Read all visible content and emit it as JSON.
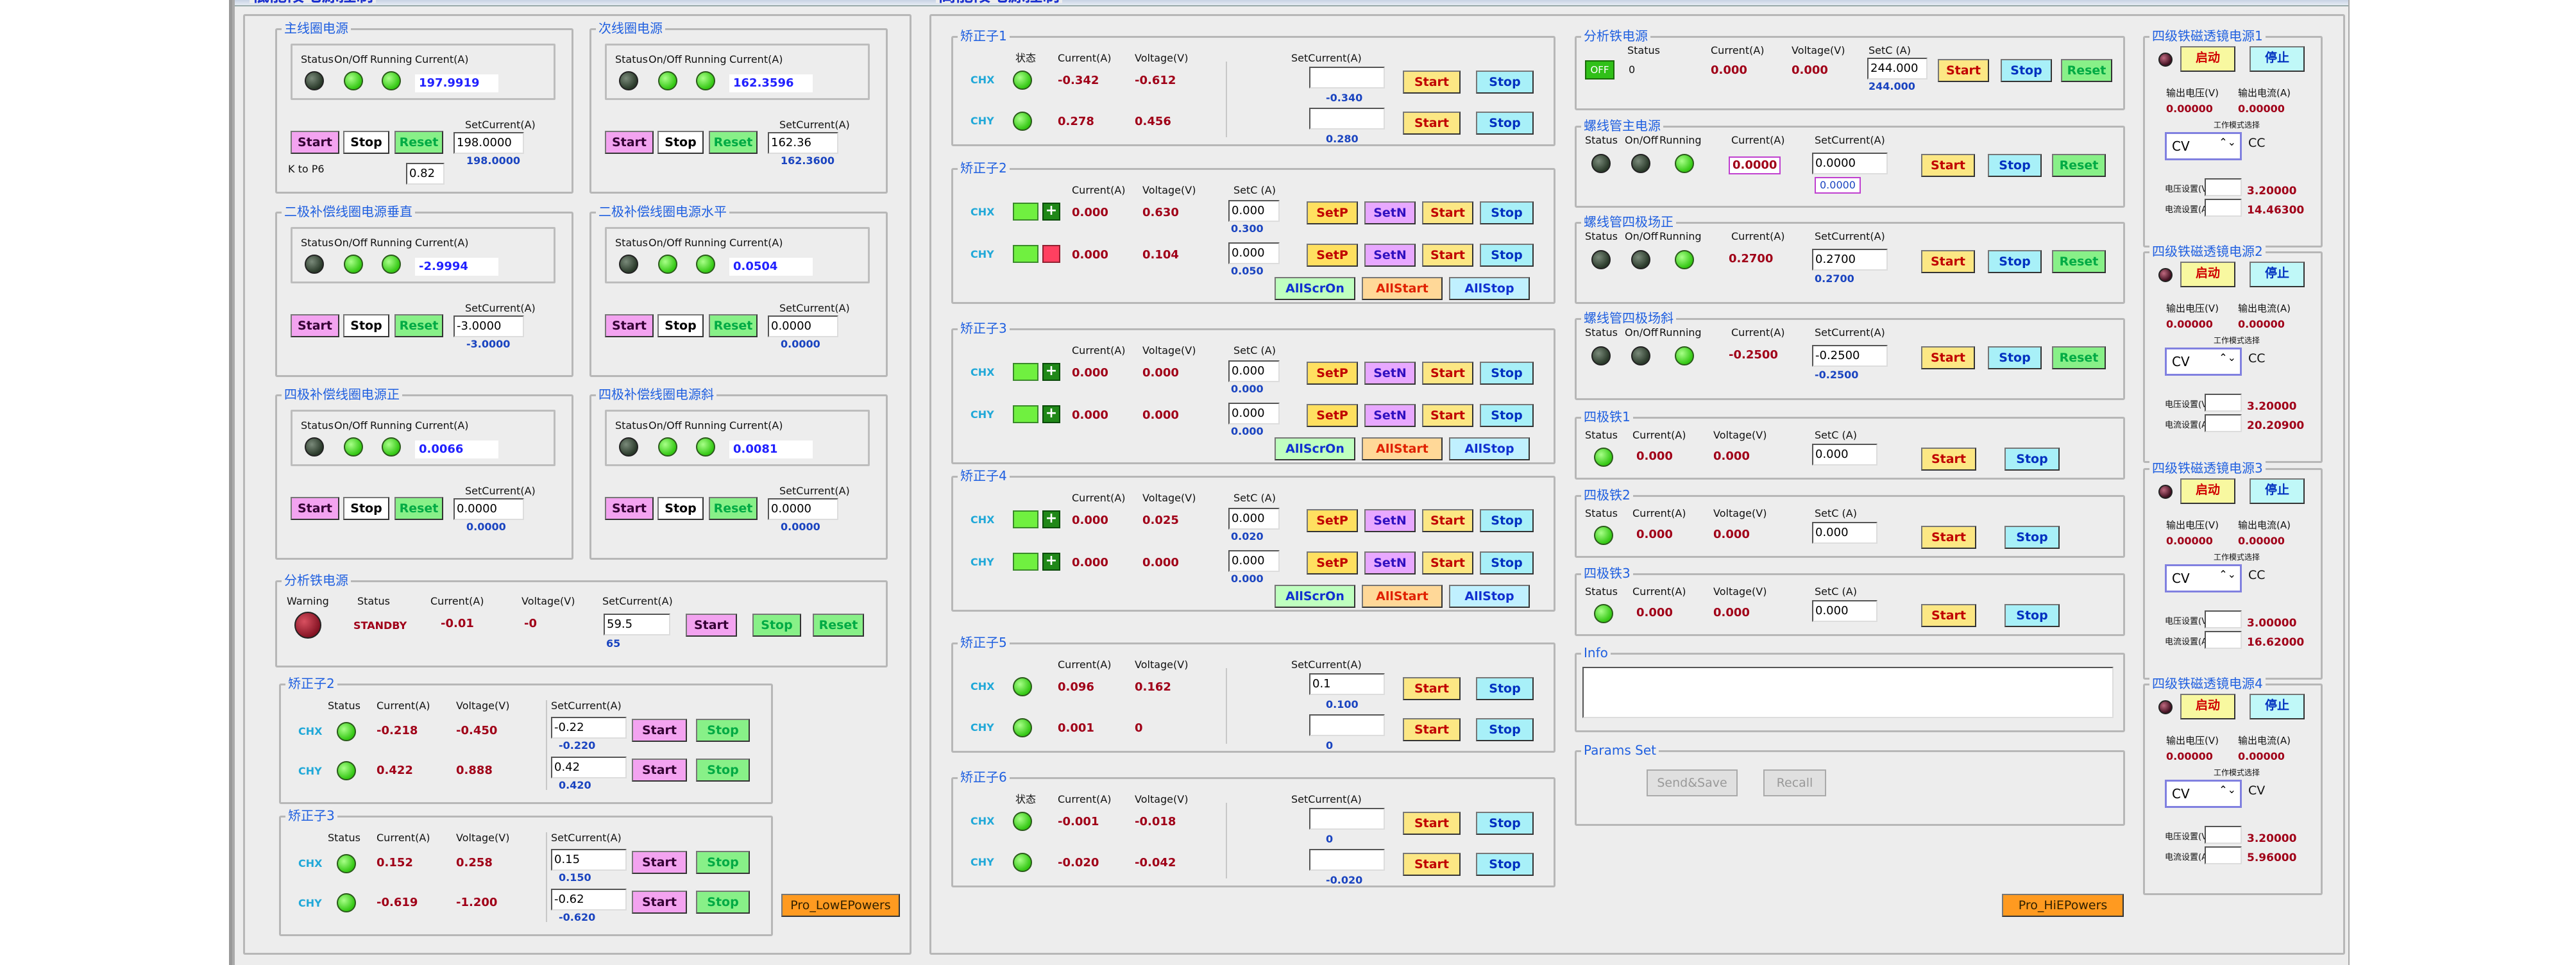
{
  "low": {
    "title": "低能段电源控制",
    "main_ps": {
      "title": "主线圈电源",
      "status": "Status",
      "onoff": "On/Off",
      "running": "Running",
      "current": "Current(A)",
      "value": "197.9919",
      "setcur": "SetCurrent(A)",
      "input": "198.0000",
      "readback": "198.0000",
      "kp": "K to P6",
      "kpv": "0.82",
      "start": "Start",
      "stop": "Stop",
      "reset": "Reset"
    },
    "sub_ps": {
      "title": "次线圈电源",
      "status": "Status",
      "onoff": "On/Off",
      "running": "Running",
      "current": "Current(A)",
      "value": "162.3596",
      "setcur": "SetCurrent(A)",
      "input": "162.36",
      "readback": "162.3600",
      "start": "Start",
      "stop": "Stop",
      "reset": "Reset"
    },
    "dip_v": {
      "title": "二极补偿线圈电源垂直",
      "status": "Status",
      "onoff": "On/Off",
      "running": "Running",
      "current": "Current(A)",
      "value": "-2.9994",
      "setcur": "SetCurrent(A)",
      "input": "-3.0000",
      "readback": "-3.0000",
      "start": "Start",
      "stop": "Stop",
      "reset": "Reset"
    },
    "dip_h": {
      "title": "二极补偿线圈电源水平",
      "status": "Status",
      "onoff": "On/Off",
      "running": "Running",
      "current": "Current(A)",
      "value": "0.0504",
      "setcur": "SetCurrent(A)",
      "input": "0.0000",
      "readback": "0.0000",
      "start": "Start",
      "stop": "Stop",
      "reset": "Reset"
    },
    "quad_n": {
      "title": "四极补偿线圈电源正",
      "status": "Status",
      "onoff": "On/Off",
      "running": "Running",
      "current": "Current(A)",
      "value": "0.0066",
      "setcur": "SetCurrent(A)",
      "input": "0.0000",
      "readback": "0.0000",
      "start": "Start",
      "stop": "Stop",
      "reset": "Reset"
    },
    "quad_s": {
      "title": "四极补偿线圈电源斜",
      "status": "Status",
      "onoff": "On/Off",
      "running": "Running",
      "current": "Current(A)",
      "value": "0.0081",
      "setcur": "SetCurrent(A)",
      "input": "0.0000",
      "readback": "0.0000",
      "start": "Start",
      "stop": "Stop",
      "reset": "Reset"
    },
    "analyzer": {
      "title": "分析铁电源",
      "warning": "Warning",
      "status": "Status",
      "current": "Current(A)",
      "voltage": "Voltage(V)",
      "setcur": "SetCurrent(A)",
      "status_val": "STANDBY",
      "cur_val": "-0.01",
      "volt_val": "-0",
      "input": "59.5",
      "readback": "65",
      "start": "Start",
      "stop": "Stop",
      "reset": "Reset"
    },
    "corr2": {
      "title": "矫正子2",
      "status": "Status",
      "current": "Current(A)",
      "voltage": "Voltage(V)",
      "setcur": "SetCurrent(A)",
      "chx": "CHX",
      "chy": "CHY",
      "x_cur": "-0.218",
      "x_volt": "-0.450",
      "x_in": "-0.22",
      "x_rb": "-0.220",
      "y_cur": "0.422",
      "y_volt": "0.888",
      "y_in": "0.42",
      "y_rb": "0.420",
      "start": "Start",
      "stop": "Stop"
    },
    "corr3": {
      "title": "矫正子3",
      "status": "Status",
      "current": "Current(A)",
      "voltage": "Voltage(V)",
      "setcur": "SetCurrent(A)",
      "chx": "CHX",
      "chy": "CHY",
      "x_cur": "0.152",
      "x_volt": "0.258",
      "x_in": "0.15",
      "x_rb": "0.150",
      "y_cur": "-0.619",
      "y_volt": "-1.200",
      "y_in": "-0.62",
      "y_rb": "-0.620",
      "start": "Start",
      "stop": "Stop"
    },
    "pro_btn": "Pro_LowEPowers"
  },
  "high": {
    "title": "高能段电源控制",
    "c1": {
      "title": "矫正子1",
      "state": "状态",
      "current": "Current(A)",
      "voltage": "Voltage(V)",
      "setcur": "SetCurrent(A)",
      "chx": "CHX",
      "chy": "CHY",
      "x_cur": "-0.342",
      "x_volt": "-0.612",
      "x_in": "",
      "x_rb": "-0.340",
      "y_cur": "0.278",
      "y_volt": "0.456",
      "y_in": "",
      "y_rb": "0.280",
      "start": "Start",
      "stop": "Stop"
    },
    "c2": {
      "title": "矫正子2",
      "current": "Current(A)",
      "voltage": "Voltage(V)",
      "setc": "SetC (A)",
      "chx": "CHX",
      "chy": "CHY",
      "x_cur": "0.000",
      "x_volt": "0.630",
      "x_in": "0.000",
      "x_rb": "0.300",
      "y_cur": "0.000",
      "y_volt": "0.104",
      "y_in": "0.000",
      "y_rb": "0.050",
      "setp": "SetP",
      "setn": "SetN",
      "start": "Start",
      "stop": "Stop",
      "allon": "AllScrOn",
      "allstart": "AllStart",
      "allstop": "AllStop"
    },
    "c3": {
      "title": "矫正子3",
      "current": "Current(A)",
      "voltage": "Voltage(V)",
      "setc": "SetC (A)",
      "chx": "CHX",
      "chy": "CHY",
      "x_cur": "0.000",
      "x_volt": "0.000",
      "x_in": "0.000",
      "x_rb": "0.000",
      "y_cur": "0.000",
      "y_volt": "0.000",
      "y_in": "0.000",
      "y_rb": "0.000",
      "setp": "SetP",
      "setn": "SetN",
      "start": "Start",
      "stop": "Stop",
      "allon": "AllScrOn",
      "allstart": "AllStart",
      "allstop": "AllStop",
      "plus": "+"
    },
    "c4": {
      "title": "矫正子4",
      "current": "Current(A)",
      "voltage": "Voltage(V)",
      "setc": "SetC (A)",
      "chx": "CHX",
      "chy": "CHY",
      "x_cur": "0.000",
      "x_volt": "0.025",
      "x_in": "0.000",
      "x_rb": "0.020",
      "y_cur": "0.000",
      "y_volt": "0.000",
      "y_in": "0.000",
      "y_rb": "0.000",
      "setp": "SetP",
      "setn": "SetN",
      "start": "Start",
      "stop": "Stop",
      "allon": "AllScrOn",
      "allstart": "AllStart",
      "allstop": "AllStop"
    },
    "c5": {
      "title": "矫正子5",
      "current": "Current(A)",
      "voltage": "Voltage(V)",
      "setcur": "SetCurrent(A)",
      "chx": "CHX",
      "chy": "CHY",
      "x_cur": "0.096",
      "x_volt": "0.162",
      "x_in": "0.1",
      "x_rb": "0.100",
      "y_cur": "0.001",
      "y_volt": "0",
      "y_in": "",
      "y_rb": "0",
      "start": "Start",
      "stop": "Stop"
    },
    "c6": {
      "title": "矫正子6",
      "state": "状态",
      "current": "Current(A)",
      "voltage": "Voltage(V)",
      "setcur": "SetCurrent(A)",
      "chx": "CHX",
      "chy": "CHY",
      "x_cur": "-0.001",
      "x_volt": "-0.018",
      "x_in": "",
      "x_rb": "0",
      "y_cur": "-0.020",
      "y_volt": "-0.042",
      "y_in": "",
      "y_rb": "-0.020",
      "start": "Start",
      "stop": "Stop"
    },
    "an": {
      "title": "分析铁电源",
      "status": "Status",
      "current": "Current(A)",
      "voltage": "Voltage(V)",
      "setc": "SetC (A)",
      "off": "OFF",
      "status_val": "0",
      "cur_val": "0.000",
      "volt_val": "0.000",
      "input": "244.000",
      "readback": "244.000",
      "start": "Start",
      "stop": "Stop",
      "reset": "Reset"
    },
    "sol": {
      "title": "螺线管主电源",
      "status": "Status",
      "onoff": "On/Off",
      "running": "Running",
      "current": "Current(A)",
      "setcur": "SetCurrent(A)",
      "value": "0.0000",
      "input": "0.0000",
      "readback": "0.0000",
      "start": "Start",
      "stop": "Stop",
      "reset": "Reset"
    },
    "sol_p": {
      "title": "螺线管四极场正",
      "status": "Status",
      "onoff": "On/Off",
      "running": "Running",
      "current": "Current(A)",
      "setcur": "SetCurrent(A)",
      "value": "0.2700",
      "input": "0.2700",
      "readback": "0.2700",
      "start": "Start",
      "stop": "Stop",
      "reset": "Reset"
    },
    "sol_s": {
      "title": "螺线管四极场斜",
      "status": "Status",
      "onoff": "On/Off",
      "running": "Running",
      "current": "Current(A)",
      "setcur": "SetCurrent(A)",
      "value": "-0.2500",
      "input": "-0.2500",
      "readback": "-0.2500",
      "start": "Start",
      "stop": "Stop",
      "reset": "Reset"
    },
    "q1": {
      "title": "四极铁1",
      "status": "Status",
      "current": "Current(A)",
      "voltage": "Voltage(V)",
      "setc": "SetC (A)",
      "cur": "0.000",
      "volt": "0.000",
      "input": "0.000",
      "start": "Start",
      "stop": "Stop"
    },
    "q2": {
      "title": "四极铁2",
      "status": "Status",
      "current": "Current(A)",
      "voltage": "Voltage(V)",
      "setc": "SetC (A)",
      "cur": "0.000",
      "volt": "0.000",
      "input": "0.000",
      "start": "Start",
      "stop": "Stop"
    },
    "q3": {
      "title": "四极铁3",
      "status": "Status",
      "current": "Current(A)",
      "voltage": "Voltage(V)",
      "setc": "SetC (A)",
      "cur": "0.000",
      "volt": "0.000",
      "input": "0.000",
      "start": "Start",
      "stop": "Stop"
    },
    "info": {
      "title": "Info"
    },
    "params": {
      "title": "Params Set",
      "send": "Send&Save",
      "recall": "Recall"
    },
    "pro_btn": "Pro_HiEPowers",
    "lenses": [
      {
        "title": "四级铁磁透镜电源1",
        "start": "启动",
        "stop": "停止",
        "ov": "输出电压(V)",
        "oc": "输出电流(A)",
        "ov_val": "0.00000",
        "oc_val": "0.00000",
        "mode_lbl": "工作模式选择",
        "mode": "CV",
        "mode_r": "CC",
        "vset": "电压设置(V)",
        "cset": "电流设置(A)",
        "vset_val": "3.20000",
        "cset_val": "14.46300"
      },
      {
        "title": "四级铁磁透镜电源2",
        "start": "启动",
        "stop": "停止",
        "ov": "输出电压(V)",
        "oc": "输出电流(A)",
        "ov_val": "0.00000",
        "oc_val": "0.00000",
        "mode_lbl": "工作模式选择",
        "mode": "CV",
        "mode_r": "CC",
        "vset": "电压设置(V)",
        "cset": "电流设置(A)",
        "vset_val": "3.20000",
        "cset_val": "20.20900"
      },
      {
        "title": "四级铁磁透镜电源3",
        "start": "启动",
        "stop": "停止",
        "ov": "输出电压(V)",
        "oc": "输出电流(A)",
        "ov_val": "0.00000",
        "oc_val": "0.00000",
        "mode_lbl": "工作模式选择",
        "mode": "CV",
        "mode_r": "CC",
        "vset": "电压设置(V)",
        "cset": "电流设置(A)",
        "vset_val": "3.00000",
        "cset_val": "16.62000"
      },
      {
        "title": "四级铁磁透镜电源4",
        "start": "启动",
        "stop": "停止",
        "ov": "输出电压(V)",
        "oc": "输出电流(A)",
        "ov_val": "0.00000",
        "oc_val": "0.00000",
        "mode_lbl": "工作模式选择",
        "mode": "CV",
        "mode_r": "CV",
        "vset": "电压设置(V)",
        "cset": "电流设置(A)",
        "vset_val": "3.20000",
        "cset_val": "5.96000"
      }
    ]
  }
}
